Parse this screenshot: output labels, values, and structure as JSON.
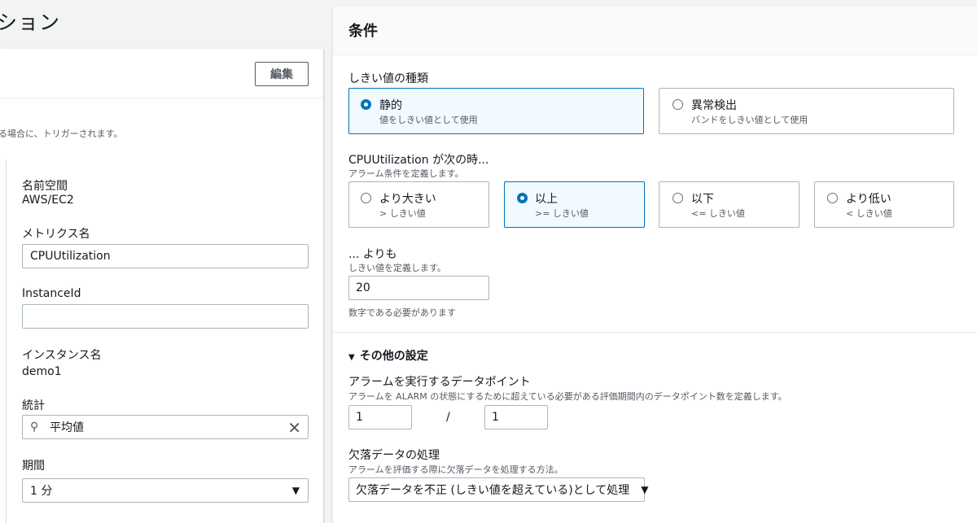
{
  "left": {
    "title": "ション",
    "edit_label": "編集",
    "trigger_desc": "る場合に、トリガーされます。",
    "namespace": {
      "label": "名前空間",
      "value": "AWS/EC2"
    },
    "metric_name": {
      "label": "メトリクス名",
      "value": "CPUUtilization"
    },
    "instance_id": {
      "label": "InstanceId",
      "value": ""
    },
    "instance_name": {
      "label": "インスタンス名",
      "value": "demo1"
    },
    "statistic": {
      "label": "統計",
      "value": "平均値"
    },
    "period": {
      "label": "期間",
      "value": "1 分"
    }
  },
  "conditions": {
    "title": "条件",
    "threshold_type": {
      "label": "しきい値の種類",
      "options": [
        {
          "title": "静的",
          "desc": "値をしきい値として使用",
          "selected": true
        },
        {
          "title": "異常検出",
          "desc": "バンドをしきい値として使用",
          "selected": false
        }
      ]
    },
    "when": {
      "label": "CPUUtilization が次の時...",
      "desc": "アラーム条件を定義します。",
      "options": [
        {
          "title": "より大きい",
          "desc": "> しきい値",
          "selected": false
        },
        {
          "title": "以上",
          "desc": ">= しきい値",
          "selected": true
        },
        {
          "title": "以下",
          "desc": "<= しきい値",
          "selected": false
        },
        {
          "title": "より低い",
          "desc": "< しきい値",
          "selected": false
        }
      ]
    },
    "than": {
      "label": "... よりも",
      "desc": "しきい値を定義します。",
      "value": "20",
      "hint": "数字である必要があります"
    },
    "additional": {
      "toggle_label": "その他の設定",
      "datapoints": {
        "label": "アラームを実行するデータポイント",
        "desc": "アラームを ALARM の状態にするために超えている必要がある評価期間内のデータポイント数を定義します。",
        "value1": "1",
        "separator": "/",
        "value2": "1"
      },
      "missing": {
        "label": "欠落データの処理",
        "desc": "アラームを評価する際に欠落データを処理する方法。",
        "value": "欠落データを不正 (しきい値を超えている)として処理"
      }
    }
  },
  "colors": {
    "accent": "#0073bb",
    "selected_bg": "#f1faff",
    "border": "#aab7b8"
  }
}
